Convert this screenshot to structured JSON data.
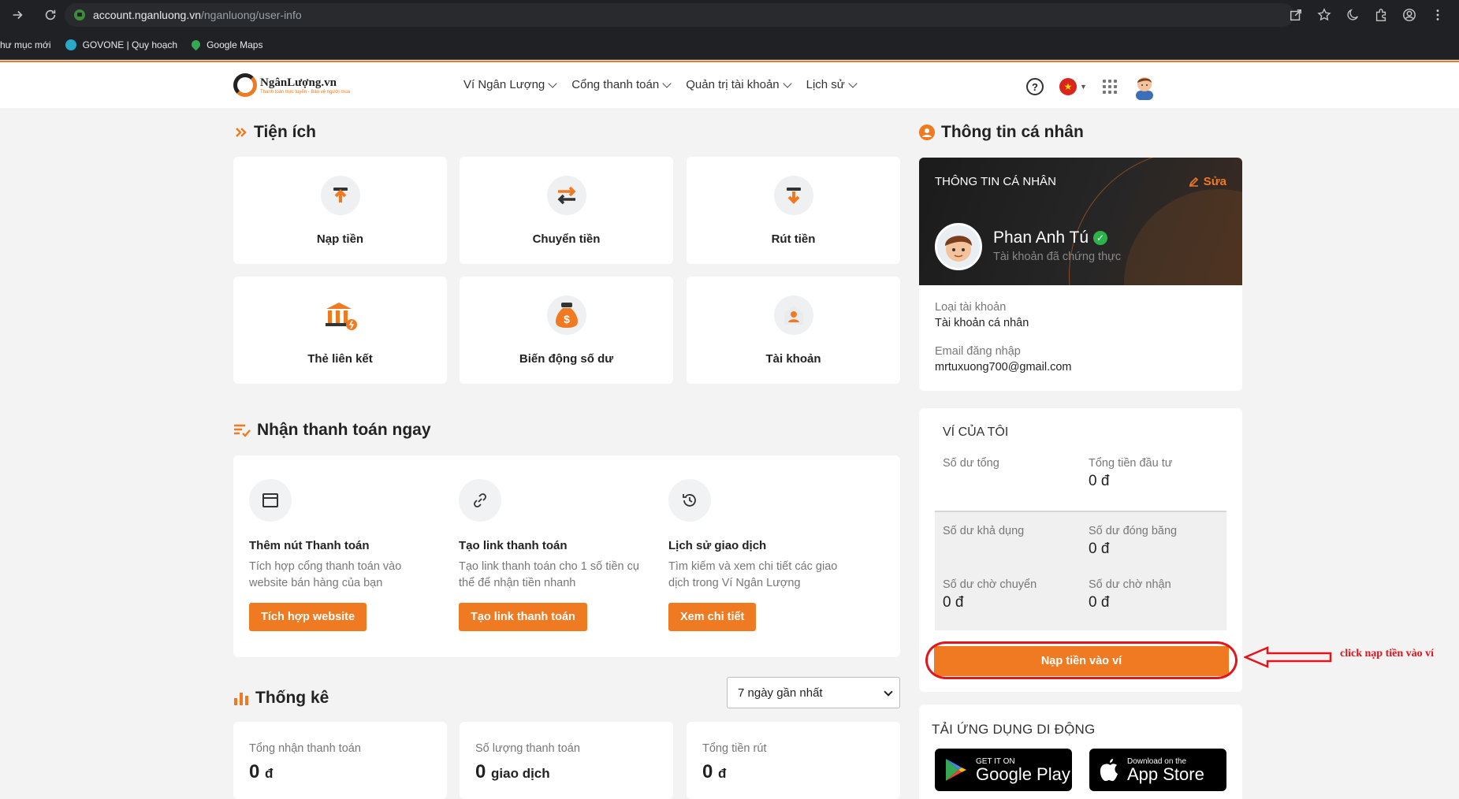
{
  "browser": {
    "url_host": "account.nganluong.vn",
    "url_path": "/nganluong/user-info",
    "bookmarks": [
      "hư mục mới",
      "GOVONE | Quy hoạch",
      "Google Maps"
    ]
  },
  "header": {
    "logo_name": "NgânLượng.vn",
    "logo_tagline": "Thanh toán trực tuyến - Bảo vệ người mua",
    "menu": [
      "Ví Ngân Lượng",
      "Cổng thanh toán",
      "Quản trị tài khoản",
      "Lịch sử"
    ]
  },
  "utilities": {
    "title": "Tiện ích",
    "tiles": [
      {
        "label": "Nạp tiền",
        "icon": "deposit-icon"
      },
      {
        "label": "Chuyển tiền",
        "icon": "transfer-icon"
      },
      {
        "label": "Rút tiền",
        "icon": "withdraw-icon"
      },
      {
        "label": "Thẻ liên kết",
        "icon": "linked-card-icon"
      },
      {
        "label": "Biến động số dư",
        "icon": "money-bag-icon"
      },
      {
        "label": "Tài khoản",
        "icon": "account-icon"
      }
    ]
  },
  "receive": {
    "title": "Nhận thanh toán ngay",
    "items": [
      {
        "title": "Thêm nút Thanh toán",
        "desc": "Tích hợp cổng thanh toán vào website bán hàng của bạn",
        "button": "Tích hợp website"
      },
      {
        "title": "Tạo link thanh toán",
        "desc": "Tạo link thanh toán cho 1 số tiền cụ thể để nhận tiền nhanh",
        "button": "Tạo link thanh toán"
      },
      {
        "title": "Lịch sử giao dịch",
        "desc": "Tìm kiếm và xem chi tiết các giao dịch trong Ví Ngân Lượng",
        "button": "Xem chi tiết"
      }
    ]
  },
  "stats": {
    "title": "Thống kê",
    "period": "7 ngày gần nhất",
    "items": [
      {
        "label": "Tổng nhận thanh toán",
        "value": "0",
        "unit": "đ"
      },
      {
        "label": "Số lượng thanh toán",
        "value": "0",
        "unit": "giao dịch"
      },
      {
        "label": "Tổng tiền rút",
        "value": "0",
        "unit": "đ"
      }
    ]
  },
  "profile": {
    "section_title": "Thông tin cá nhân",
    "card_title": "THÔNG TIN CÁ NHÂN",
    "edit_label": "Sửa",
    "name": "Phan Anh Tú",
    "status": "Tài khoản đã chứng thực",
    "account_type_label": "Loại tài khoản",
    "account_type": "Tài khoản cá nhân",
    "email_label": "Email đăng nhập",
    "email": "mrtuxuong700@gmail.com"
  },
  "wallet": {
    "title": "VÍ CỦA TÔI",
    "total_label": "Số dư tổng",
    "invest_label": "Tổng tiền đầu tư",
    "invest_value": "0 đ",
    "available_label": "Số dư khả dụng",
    "frozen_label": "Số dư đóng băng",
    "frozen_value": "0 đ",
    "pending_out_label": "Số dư chờ chuyển",
    "pending_out_value": "0 đ",
    "pending_in_label": "Số dư chờ nhận",
    "pending_in_value": "0 đ",
    "deposit_button": "Nạp tiền vào ví"
  },
  "annotation": {
    "text": "click nạp tiền vào ví",
    "color": "#e4141b"
  },
  "apps": {
    "title": "TẢI ỨNG DỤNG DI ĐỘNG",
    "google_small": "GET IT ON",
    "google_big": "Google Play",
    "apple_small": "Download on the",
    "apple_big": "App Store"
  },
  "colors": {
    "accent": "#f07a22",
    "dark": "#1b1b1b"
  }
}
